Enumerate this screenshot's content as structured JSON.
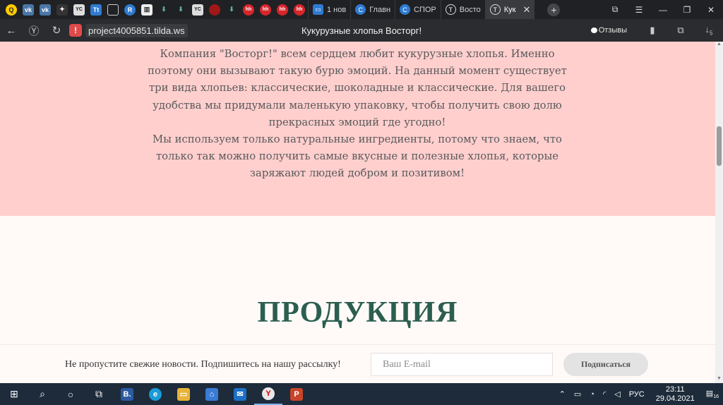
{
  "browser": {
    "tabs": [
      {
        "label": "1 нов",
        "color": "#4a76a8"
      },
      {
        "label": "Главн",
        "color": "#2f7bd1"
      },
      {
        "label": "СПОР",
        "color": "#2f7bd1"
      },
      {
        "label": "Восто",
        "color": "#555"
      },
      {
        "label": "Кук",
        "color": "#555",
        "active": true
      }
    ],
    "favicons_text": [
      "",
      "vk",
      "vk",
      "✦",
      "YC",
      "Tt",
      "▭",
      "R",
      "🏛",
      "⬇",
      "⬇",
      "YC",
      "●",
      "⬇",
      "hh",
      "hh",
      "hh",
      "hh"
    ],
    "url": "project4005851.tilda.ws",
    "warning_symbol": "!",
    "page_title": "Кукурузные хлопья Восторг!",
    "reviews_label": "Отзывы",
    "download_count": "5"
  },
  "page": {
    "about_text_p1": "Компания \"Восторг!\" всем сердцем любит кукурузные хлопья. Именно поэтому они вызывают такую бурю эмоций. На данный момент существует три вида хлопьев: классические, шоколадные и классические. Для вашего удобства мы придумали маленькую упаковку, чтобы получить свою долю прекрасных эмоций где угодно!",
    "about_text_p2": "Мы используем только натуральные ингредиенты, потому что знаем, что только так можно получить самые вкусные и полезные хлопья, которые заряжают людей добром и позитивом!",
    "products_title": "ПРОДУКЦИЯ"
  },
  "subscribe": {
    "text": "Не пропустите свежие новости. Подпишитесь на нашу рассылку!",
    "email_placeholder": "Ваш E-mail",
    "button_label": "Подписаться"
  },
  "taskbar": {
    "language": "РУС",
    "time": "23:11",
    "date": "29.04.2021",
    "notification_count": "16"
  },
  "colors": {
    "about_bg": "#ffcfce",
    "title": "#2c5e50",
    "page_bg": "#fffaf8"
  }
}
